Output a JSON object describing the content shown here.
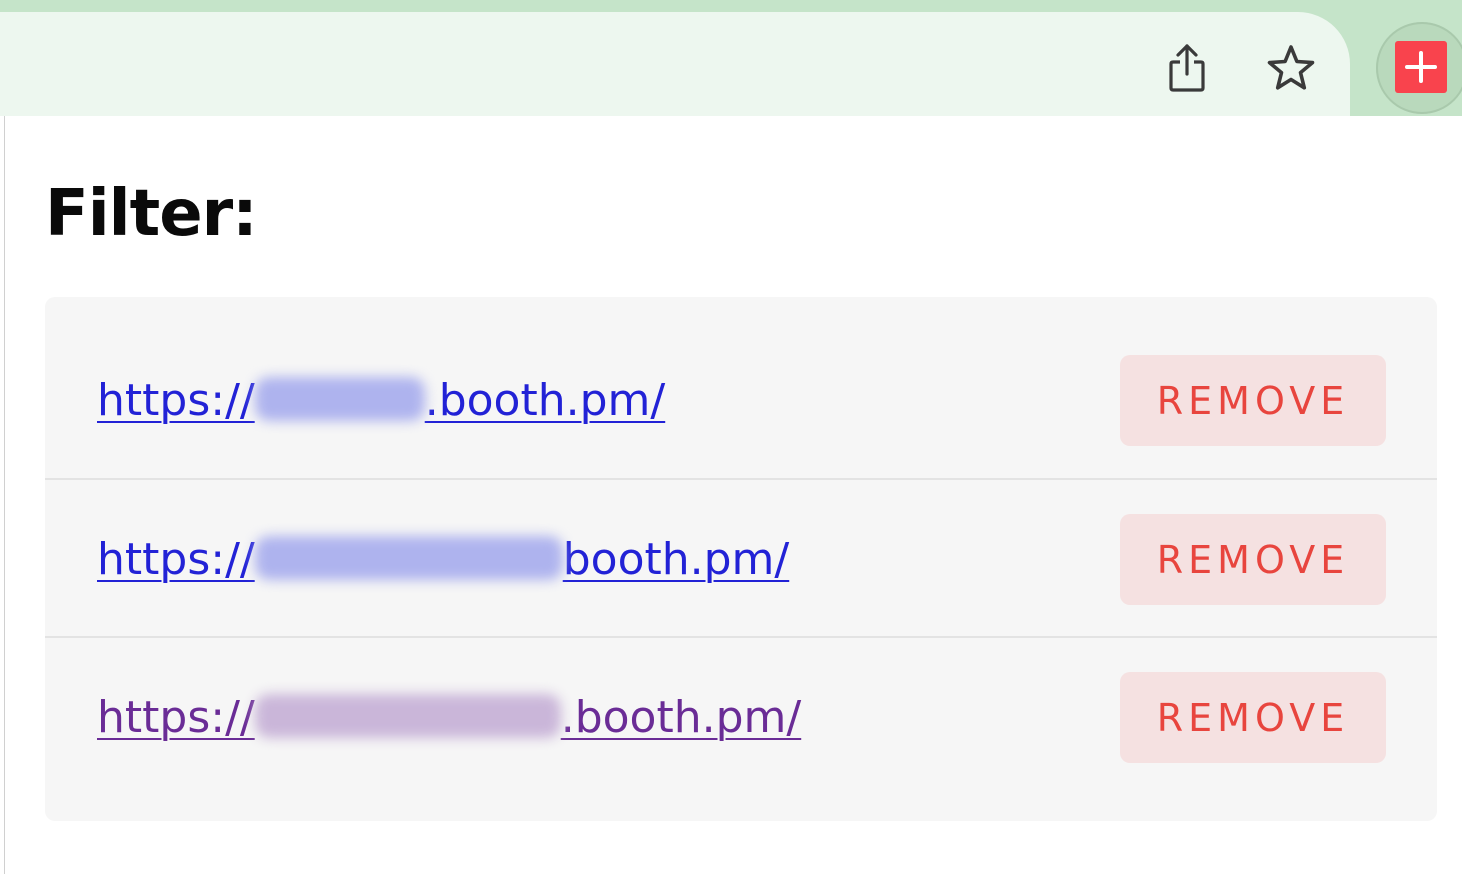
{
  "browser": {
    "accent_color": "#c5e4c9",
    "icons": [
      "share-icon",
      "star-icon",
      "extension-plus-icon"
    ]
  },
  "popup": {
    "title": "Filter:",
    "filters": [
      {
        "prefix": "https://",
        "suffix": ".booth.pm/",
        "state": "unvisited"
      },
      {
        "prefix": "https://",
        "suffix": "booth.pm/",
        "state": "unvisited"
      },
      {
        "prefix": "https://",
        "suffix": ".booth.pm/",
        "state": "visited"
      }
    ],
    "remove_label": "REMOVE",
    "remove_color": "#e8453e",
    "link_color": "#2222d6",
    "visited_link_color": "#6a2c96"
  }
}
